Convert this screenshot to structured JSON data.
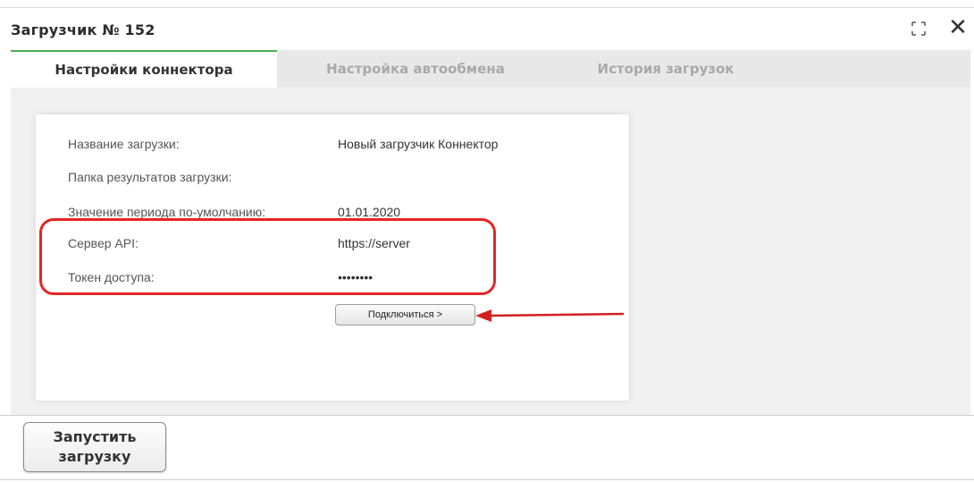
{
  "window": {
    "title": "Загрузчик № 152"
  },
  "icons": {
    "expand": "expand-icon",
    "close": "close-icon",
    "arrow": "arrow-icon"
  },
  "tabs": [
    {
      "label": "Настройки коннектора",
      "active": true
    },
    {
      "label": "Настройка автообмена",
      "active": false
    },
    {
      "label": "История загрузок",
      "active": false
    }
  ],
  "form": {
    "name": {
      "label": "Название загрузки:",
      "value": "Новый загрузчик Коннектор"
    },
    "folder": {
      "label": "Папка результатов загрузки:",
      "value": ""
    },
    "period": {
      "label": "Значение периода по-умолчанию:",
      "value": "01.01.2020"
    },
    "server": {
      "label": "Сервер API:",
      "value": "https://server"
    },
    "token": {
      "label": "Токен доступа:",
      "value": "••••••••"
    }
  },
  "buttons": {
    "connect": "Подключиться >",
    "start_line1": "Запустить",
    "start_line2": "загрузку"
  },
  "colors": {
    "accent_tab": "#4caf50",
    "highlight": "#e52525"
  }
}
